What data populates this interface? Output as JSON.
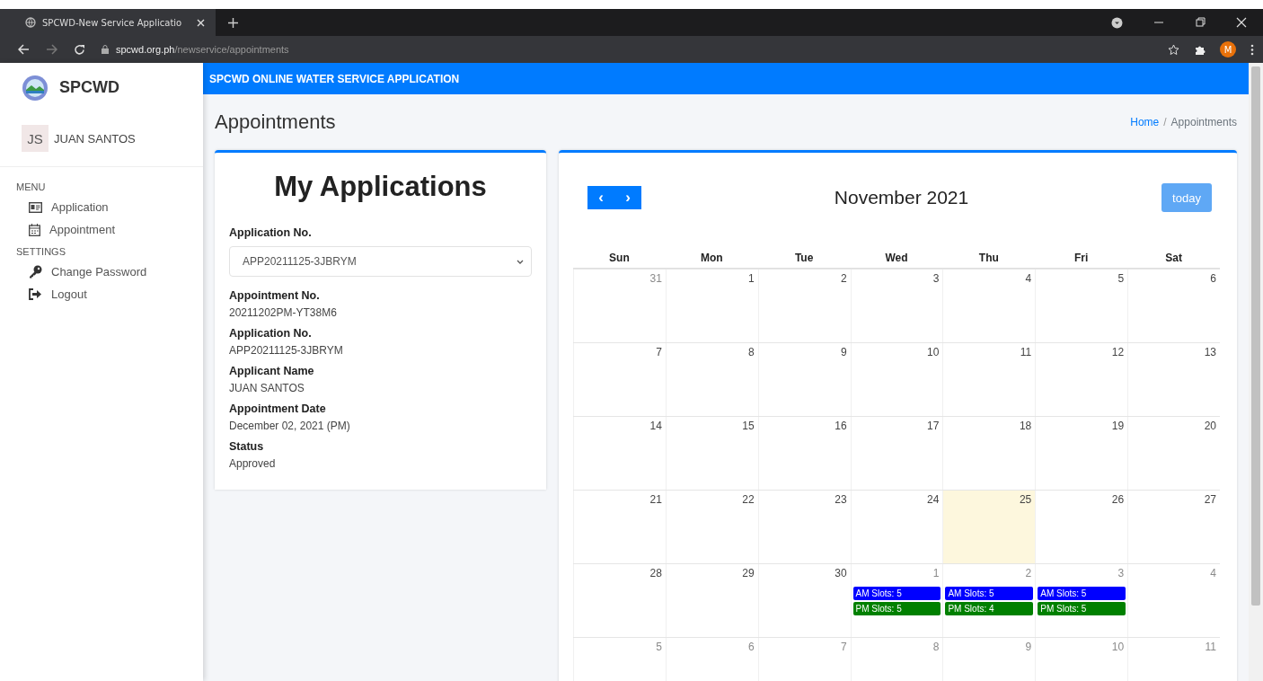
{
  "browser": {
    "tab_title": "SPCWD-New Service Applicatio",
    "url_host": "spcwd.org.ph",
    "url_path": "/newservice/appointments",
    "profile_initial": "M"
  },
  "sidebar": {
    "brand": "SPCWD",
    "user": {
      "initials": "JS",
      "name": "JUAN SANTOS"
    },
    "sections": [
      {
        "heading": "MENU",
        "items": [
          {
            "label": "Application"
          },
          {
            "label": "Appointment"
          }
        ]
      },
      {
        "heading": "SETTINGS",
        "items": [
          {
            "label": "Change Password"
          },
          {
            "label": "Logout"
          }
        ]
      }
    ]
  },
  "topbar": {
    "title": "SPCWD ONLINE WATER SERVICE APPLICATION"
  },
  "page": {
    "title": "Appointments",
    "breadcrumb_separator": "/",
    "breadcrumb": [
      {
        "label": "Home",
        "link": true
      },
      {
        "label": "Appointments",
        "link": false
      }
    ]
  },
  "applications": {
    "title": "My Applications",
    "select_label": "Application No.",
    "select_value": "APP20211125-3JBRYM",
    "details": [
      {
        "label": "Appointment No.",
        "value": "20211202PM-YT38M6"
      },
      {
        "label": "Application No.",
        "value": "APP20211125-3JBRYM"
      },
      {
        "label": "Applicant Name",
        "value": "JUAN SANTOS"
      },
      {
        "label": "Appointment Date",
        "value": "December 02, 2021 (PM)"
      },
      {
        "label": "Status",
        "value": "Approved"
      }
    ]
  },
  "calendar": {
    "title": "November 2021",
    "prev": "‹",
    "next": "›",
    "today_button": "today",
    "weekdays": [
      "Sun",
      "Mon",
      "Tue",
      "Wed",
      "Thu",
      "Fri",
      "Sat"
    ],
    "weeks": [
      [
        {
          "day": "31",
          "other_month": true,
          "today": false
        },
        {
          "day": "1",
          "other_month": false,
          "today": false
        },
        {
          "day": "2",
          "other_month": false,
          "today": false
        },
        {
          "day": "3",
          "other_month": false,
          "today": false
        },
        {
          "day": "4",
          "other_month": false,
          "today": false
        },
        {
          "day": "5",
          "other_month": false,
          "today": false
        },
        {
          "day": "6",
          "other_month": false,
          "today": false
        }
      ],
      [
        {
          "day": "7",
          "other_month": false,
          "today": false
        },
        {
          "day": "8",
          "other_month": false,
          "today": false
        },
        {
          "day": "9",
          "other_month": false,
          "today": false
        },
        {
          "day": "10",
          "other_month": false,
          "today": false
        },
        {
          "day": "11",
          "other_month": false,
          "today": false
        },
        {
          "day": "12",
          "other_month": false,
          "today": false
        },
        {
          "day": "13",
          "other_month": false,
          "today": false
        }
      ],
      [
        {
          "day": "14",
          "other_month": false,
          "today": false
        },
        {
          "day": "15",
          "other_month": false,
          "today": false
        },
        {
          "day": "16",
          "other_month": false,
          "today": false
        },
        {
          "day": "17",
          "other_month": false,
          "today": false
        },
        {
          "day": "18",
          "other_month": false,
          "today": false
        },
        {
          "day": "19",
          "other_month": false,
          "today": false
        },
        {
          "day": "20",
          "other_month": false,
          "today": false
        }
      ],
      [
        {
          "day": "21",
          "other_month": false,
          "today": false
        },
        {
          "day": "22",
          "other_month": false,
          "today": false
        },
        {
          "day": "23",
          "other_month": false,
          "today": false
        },
        {
          "day": "24",
          "other_month": false,
          "today": false
        },
        {
          "day": "25",
          "other_month": false,
          "today": true
        },
        {
          "day": "26",
          "other_month": false,
          "today": false
        },
        {
          "day": "27",
          "other_month": false,
          "today": false
        }
      ],
      [
        {
          "day": "28",
          "other_month": false,
          "today": false
        },
        {
          "day": "29",
          "other_month": false,
          "today": false
        },
        {
          "day": "30",
          "other_month": false,
          "today": false
        },
        {
          "day": "1",
          "other_month": true,
          "today": false,
          "events": [
            {
              "label": "AM Slots: 5",
              "color": "#0000ff"
            },
            {
              "label": "PM Slots: 5",
              "color": "#008000"
            }
          ]
        },
        {
          "day": "2",
          "other_month": true,
          "today": false,
          "events": [
            {
              "label": "AM Slots: 5",
              "color": "#0000ff"
            },
            {
              "label": "PM Slots: 4",
              "color": "#008000"
            }
          ]
        },
        {
          "day": "3",
          "other_month": true,
          "today": false,
          "events": [
            {
              "label": "AM Slots: 5",
              "color": "#0000ff"
            },
            {
              "label": "PM Slots: 5",
              "color": "#008000"
            }
          ]
        },
        {
          "day": "4",
          "other_month": true,
          "today": false
        }
      ],
      [
        {
          "day": "5",
          "other_month": true,
          "today": false
        },
        {
          "day": "6",
          "other_month": true,
          "today": false
        },
        {
          "day": "7",
          "other_month": true,
          "today": false
        },
        {
          "day": "8",
          "other_month": true,
          "today": false
        },
        {
          "day": "9",
          "other_month": true,
          "today": false
        },
        {
          "day": "10",
          "other_month": true,
          "today": false
        },
        {
          "day": "11",
          "other_month": true,
          "today": false
        }
      ]
    ]
  }
}
